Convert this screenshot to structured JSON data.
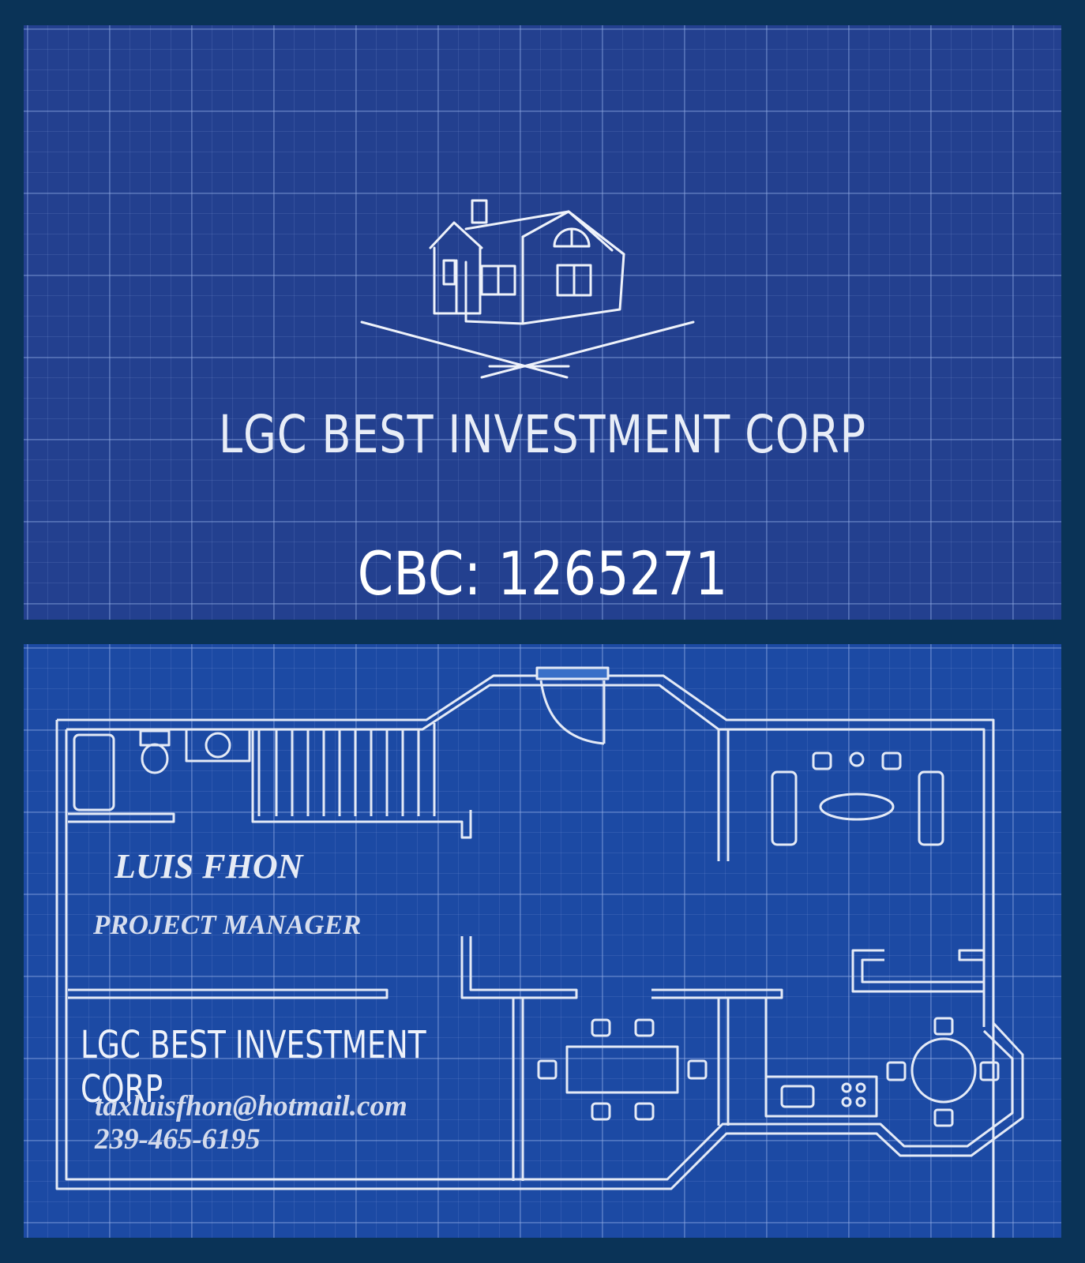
{
  "front": {
    "logo": "house-logo",
    "company_name": "LGC BEST INVESTMENT CORP",
    "license": "CBC: 1265271"
  },
  "back": {
    "background": "floor-plan-blueprint",
    "name": "LUIS FHON",
    "title": "PROJECT MANAGER",
    "company_name": "LGC BEST INVESTMENT CORP",
    "email": "taxluisfhon@hotmail.com",
    "phone": "239-465-6195"
  },
  "colors": {
    "page_background": "#0a3357",
    "card_front": "#23408f",
    "card_back": "#1c4aa4",
    "lines": "#e8edf7"
  }
}
